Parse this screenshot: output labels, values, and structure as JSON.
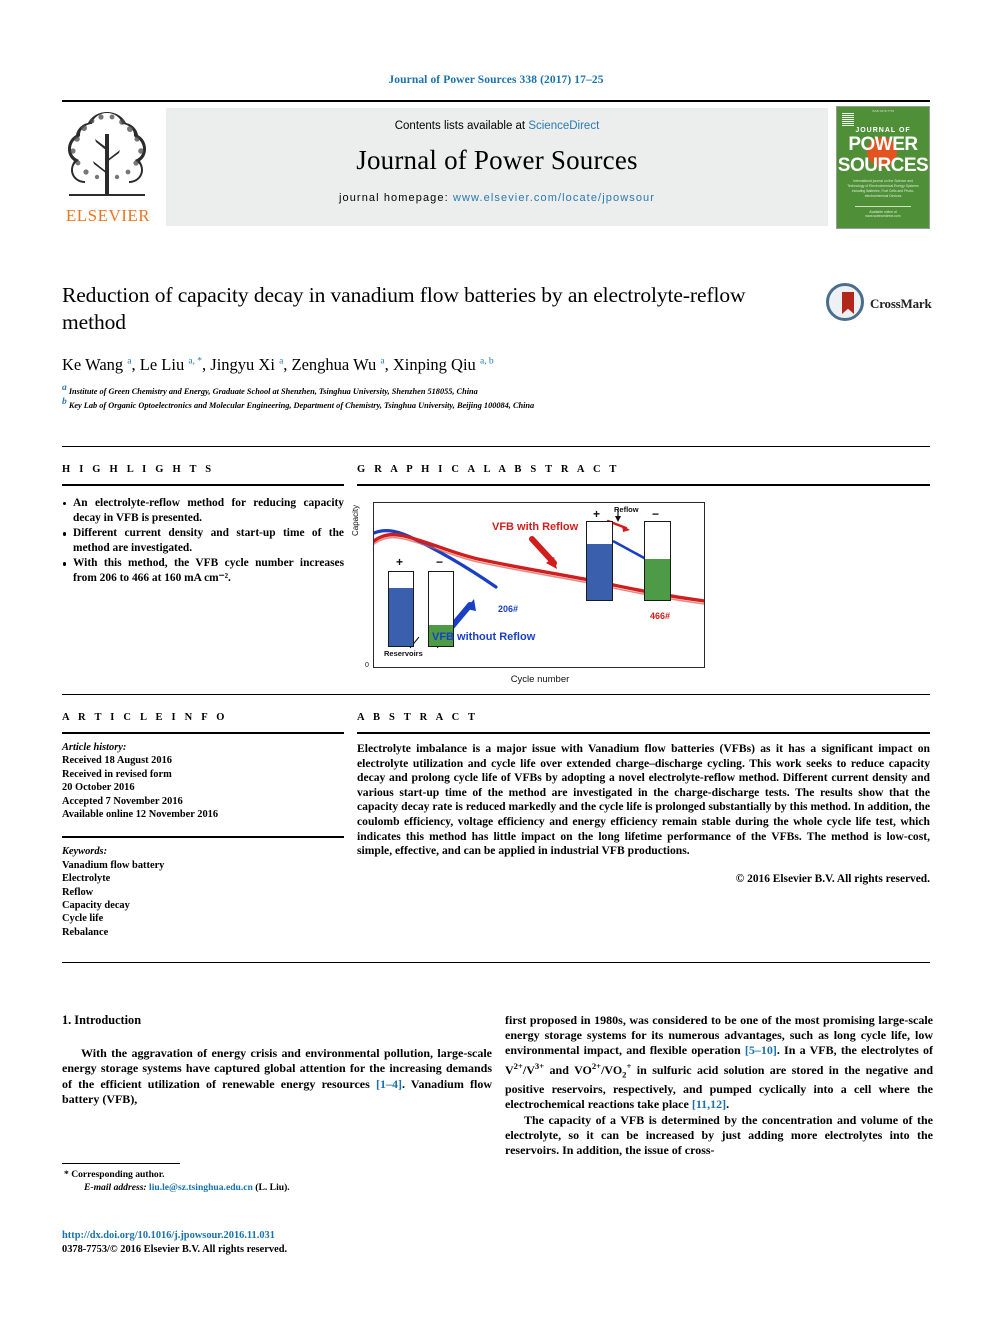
{
  "running_head": "Journal of Power Sources 338 (2017) 17–25",
  "masthead": {
    "contents_prefix": "Contents lists available at ",
    "contents_link": "ScienceDirect",
    "journal_name": "Journal of Power Sources",
    "homepage_prefix": "journal homepage: ",
    "homepage_url": "www.elsevier.com/locate/jpowsour",
    "publisher": "ELSEVIER",
    "cover": {
      "top_line": "ISSN 0378-7753",
      "journal_of": "JOURNAL OF",
      "power": "POWER",
      "sources": "SOURCES",
      "blurb": "International journal on the Science and Technology of Electrochemical Energy Systems including Batteries, Fuel Cells and Photo-electrochemical Devices",
      "footer": "Available online at www.sciencedirect.com"
    }
  },
  "article": {
    "title": "Reduction of capacity decay in vanadium flow batteries by an electrolyte-reflow method",
    "authors": [
      {
        "name": "Ke Wang",
        "marks": "a"
      },
      {
        "name": "Le Liu",
        "marks": "a, *"
      },
      {
        "name": "Jingyu Xi",
        "marks": "a"
      },
      {
        "name": "Zenghua Wu",
        "marks": "a"
      },
      {
        "name": "Xinping Qiu",
        "marks": "a, b"
      }
    ],
    "affiliations": [
      {
        "mark": "a",
        "text": "Institute of Green Chemistry and Energy, Graduate School at Shenzhen, Tsinghua University, Shenzhen 518055, China"
      },
      {
        "mark": "b",
        "text": "Key Lab of Organic Optoelectronics and Molecular Engineering, Department of Chemistry, Tsinghua University, Beijing 100084, China"
      }
    ],
    "crossmark_label": "CrossMark"
  },
  "highlights": {
    "heading": "H I G H L I G H T S",
    "items": [
      "An electrolyte-reflow method for reducing capacity decay in VFB is presented.",
      "Different current density and start-up time of the method are investigated.",
      "With this method, the VFB cycle number increases from 206 to 466 at 160 mA cm⁻²."
    ]
  },
  "graphical_abstract": {
    "heading": "G R A P H I C A L   A B S T R A C T"
  },
  "chart_data": {
    "type": "line",
    "title": "",
    "xlabel": "Cycle number",
    "ylabel": "Capacity",
    "y_origin_tick": "0",
    "grid": false,
    "legend_position": "inline-annotations",
    "annotations": [
      {
        "text": "VFB with Reflow",
        "color": "#d01e1e"
      },
      {
        "text": "VFB without Reflow",
        "color": "#1a3fc4"
      },
      {
        "text": "206#",
        "color": "#1a3fc4"
      },
      {
        "text": "466#",
        "color": "#d01e1e"
      },
      {
        "text": "Reservoirs",
        "color": "#111111"
      },
      {
        "text": "Reflow",
        "color": "#111111"
      },
      {
        "text": "+",
        "color": "#111111"
      },
      {
        "text": "−",
        "color": "#111111"
      }
    ],
    "series": [
      {
        "name": "VFB with Reflow",
        "color": "#d01e1e",
        "x": [
          0,
          20,
          40,
          70,
          100,
          140,
          180,
          220,
          260,
          300,
          340,
          380,
          420,
          466
        ],
        "values": [
          88,
          86,
          83,
          79,
          76,
          73,
          71,
          69,
          67,
          65,
          62,
          59,
          56,
          52
        ]
      },
      {
        "name": "VFB without Reflow",
        "color": "#1a3fc4",
        "x": [
          0,
          20,
          40,
          70,
          100,
          140,
          170,
          206
        ],
        "values": [
          90,
          86,
          82,
          78,
          73,
          66,
          59,
          52
        ]
      }
    ],
    "tanks": [
      {
        "label": "+",
        "fill_color": "#3a5fad",
        "fill_fraction": 0.78,
        "group": "without-reflow-start"
      },
      {
        "label": "−",
        "fill_color": "#4e9b47",
        "fill_fraction": 0.28,
        "group": "without-reflow-start"
      },
      {
        "label": "+",
        "fill_color": "#3a5fad",
        "fill_fraction": 0.72,
        "group": "with-reflow-end"
      },
      {
        "label": "−",
        "fill_color": "#4e9b47",
        "fill_fraction": 0.52,
        "group": "with-reflow-end"
      }
    ]
  },
  "article_info": {
    "heading": "A R T I C L E   I N F O",
    "history_label": "Article history:",
    "history": [
      "Received 18 August 2016",
      "Received in revised form",
      "20 October 2016",
      "Accepted 7 November 2016",
      "Available online 12 November 2016"
    ],
    "keywords_label": "Keywords:",
    "keywords": [
      "Vanadium flow battery",
      "Electrolyte",
      "Reflow",
      "Capacity decay",
      "Cycle life",
      "Rebalance"
    ]
  },
  "abstract": {
    "heading": "A B S T R A C T",
    "text": "Electrolyte imbalance is a major issue with Vanadium flow batteries (VFBs) as it has a significant impact on electrolyte utilization and cycle life over extended charge–discharge cycling. This work seeks to reduce capacity decay and prolong cycle life of VFBs by adopting a novel electrolyte-reflow method. Different current density and various start-up time of the method are investigated in the charge-discharge tests. The results show that the capacity decay rate is reduced markedly and the cycle life is prolonged substantially by this method. In addition, the coulomb efficiency, voltage efficiency and energy efficiency remain stable during the whole cycle life test, which indicates this method has little impact on the long lifetime performance of the VFBs. The method is low-cost, simple, effective, and can be applied in industrial VFB productions.",
    "copyright": "© 2016 Elsevier B.V. All rights reserved."
  },
  "body": {
    "section_number_title": "1. Introduction",
    "left_paragraph": {
      "part1": "With the aggravation of energy crisis and environmental pollution, large-scale energy storage systems have captured global attention for the increasing demands of the efficient utilization of renewable energy resources ",
      "ref1": "[1–4]",
      "part2": ". Vanadium flow battery (VFB),"
    },
    "right_paragraph_1": {
      "part1": "first proposed in 1980s, was considered to be one of the most promising large-scale energy storage systems for its numerous advantages, such as long cycle life, low environmental impact, and flexible operation ",
      "ref1": "[5–10]",
      "part2": ". In a VFB, the electrolytes of V",
      "sup1": "2+",
      "part3": "/V",
      "sup2": "3+",
      "part4": " and VO",
      "sup3": "2+",
      "part5": "/VO",
      "sub1": "2",
      "sup4": "+",
      "part6": " in sulfuric acid solution are stored in the negative and positive reservoirs, respectively, and pumped cyclically into a cell where the electrochemical reactions take place ",
      "ref2": "[11,12]",
      "part7": "."
    },
    "right_paragraph_2": "The capacity of a VFB is determined by the concentration and volume of the electrolyte, so it can be increased by just adding more electrolytes into the reservoirs. In addition, the issue of cross-"
  },
  "footnote": {
    "corresponding": "* Corresponding author.",
    "email_label": "E-mail address:",
    "email": "liu.le@sz.tsinghua.edu.cn",
    "email_owner": "(L. Liu)."
  },
  "publisher_footer": {
    "doi": "http://dx.doi.org/10.1016/j.jpowsour.2016.11.031",
    "issn_line": "0378-7753/© 2016 Elsevier B.V. All rights reserved."
  },
  "colors": {
    "link_blue": "#1a72ad",
    "elsevier_orange": "#E87722",
    "cover_green": "#4e8f38",
    "chart_red": "#d01e1e",
    "chart_blue": "#1a3fc4",
    "tank_blue": "#3a5fad",
    "tank_green": "#4e9b47"
  }
}
